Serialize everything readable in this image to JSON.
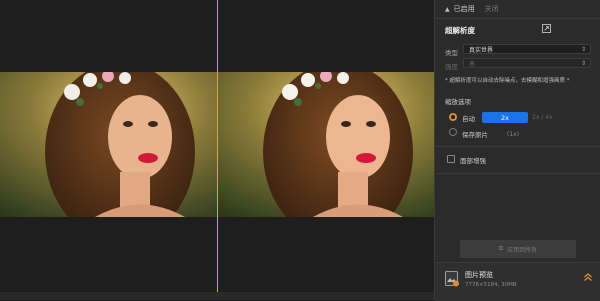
{
  "preview": {
    "left_label": "",
    "right_label": ""
  },
  "panel": {
    "toggle": {
      "label": "已启用",
      "sub": "关闭"
    },
    "section_title": "超解析度",
    "model": {
      "label": "类型",
      "value": "真实世界"
    },
    "strength": {
      "label": "强度",
      "value": "高"
    },
    "note": "* 超解析度可以自动去除噪点，去模糊和增强画质 *",
    "scale_group_label": "缩放选项",
    "option_auto": {
      "label": "自动",
      "pill": "2x",
      "grey": "2x / 4x"
    },
    "option_original": {
      "label": "保存原片",
      "note": "(1x)"
    },
    "checkbox_label": "面部增强",
    "apply_label": "应用到所有"
  },
  "footer": {
    "title": "图片预览",
    "meta": "7776×5184, 30MB"
  },
  "colors": {
    "accent": "#1a73e8",
    "radio": "#e38a3a",
    "divider": "#d4a74a",
    "panel_bg": "#2b2b2b"
  }
}
